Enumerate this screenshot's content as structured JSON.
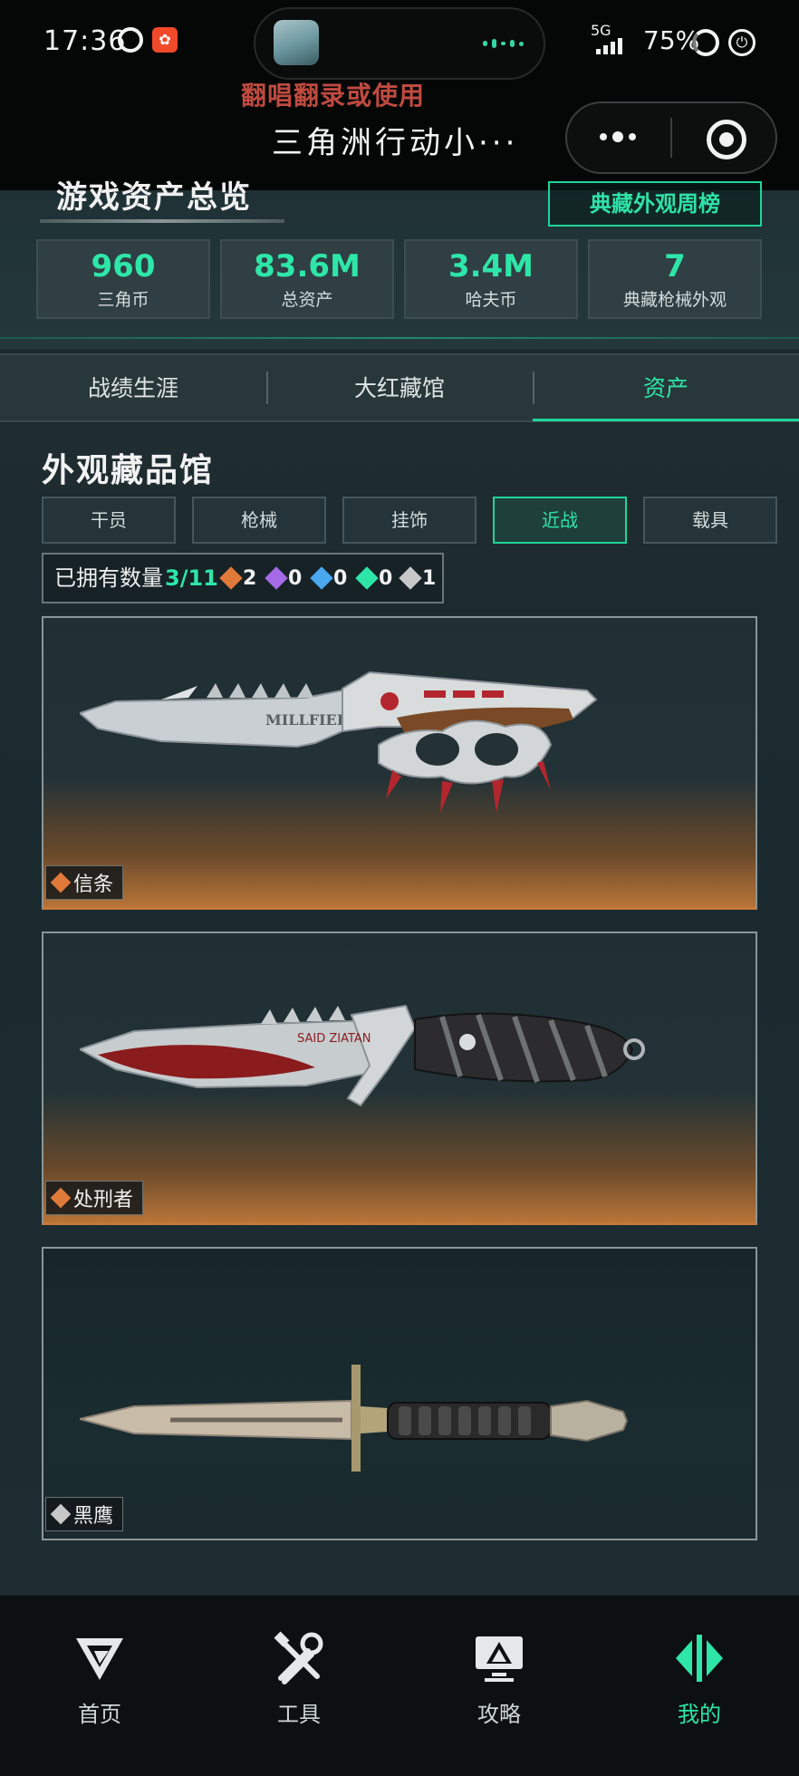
{
  "status_bar": {
    "time": "17:36",
    "network": "5G",
    "battery": "75%"
  },
  "overlay_text": "翻唱翻录或使用",
  "miniprogram": {
    "title": "三角洲行动小···"
  },
  "overview": {
    "title": "游戏资产总览",
    "rank_button": "典藏外观周榜",
    "stats": [
      {
        "value": "960",
        "label": "三角币"
      },
      {
        "value": "83.6M",
        "label": "总资产"
      },
      {
        "value": "3.4M",
        "label": "哈夫币"
      },
      {
        "value": "7",
        "label": "典藏枪械外观"
      }
    ]
  },
  "tabs": [
    {
      "label": "战绩生涯"
    },
    {
      "label": "大红藏馆"
    },
    {
      "label": "资产"
    }
  ],
  "active_tab": "资产",
  "collection": {
    "title": "外观藏品馆",
    "filters": [
      {
        "label": "干员"
      },
      {
        "label": "枪械"
      },
      {
        "label": "挂饰"
      },
      {
        "label": "近战"
      },
      {
        "label": "载具"
      }
    ],
    "active_filter": "近战",
    "owned_label": "已拥有数量",
    "owned_value": "3/11",
    "rarity_counts": [
      {
        "color": "#e07a3a",
        "count": "2"
      },
      {
        "color": "#a56ae6",
        "count": "0"
      },
      {
        "color": "#4aa8f0",
        "count": "0"
      },
      {
        "color": "#2ee6a8",
        "count": "0"
      },
      {
        "color": "#c8c8c8",
        "count": "1"
      }
    ],
    "items": [
      {
        "name": "信条",
        "rarity_color": "#e07a3a",
        "variant": "orange"
      },
      {
        "name": "处刑者",
        "rarity_color": "#e07a3a",
        "variant": "orange"
      },
      {
        "name": "黑鹰",
        "rarity_color": "#c8c8c8",
        "variant": "dark"
      }
    ]
  },
  "bottom_nav": [
    {
      "label": "首页",
      "icon": "home-logo-icon"
    },
    {
      "label": "工具",
      "icon": "tools-icon"
    },
    {
      "label": "攻略",
      "icon": "guide-monitor-icon"
    },
    {
      "label": "我的",
      "icon": "profile-logo-icon"
    }
  ],
  "active_nav": "我的",
  "colors": {
    "accent": "#2ee6a8",
    "orange_rarity": "#e07a3a",
    "background": "#1d2a2e"
  }
}
